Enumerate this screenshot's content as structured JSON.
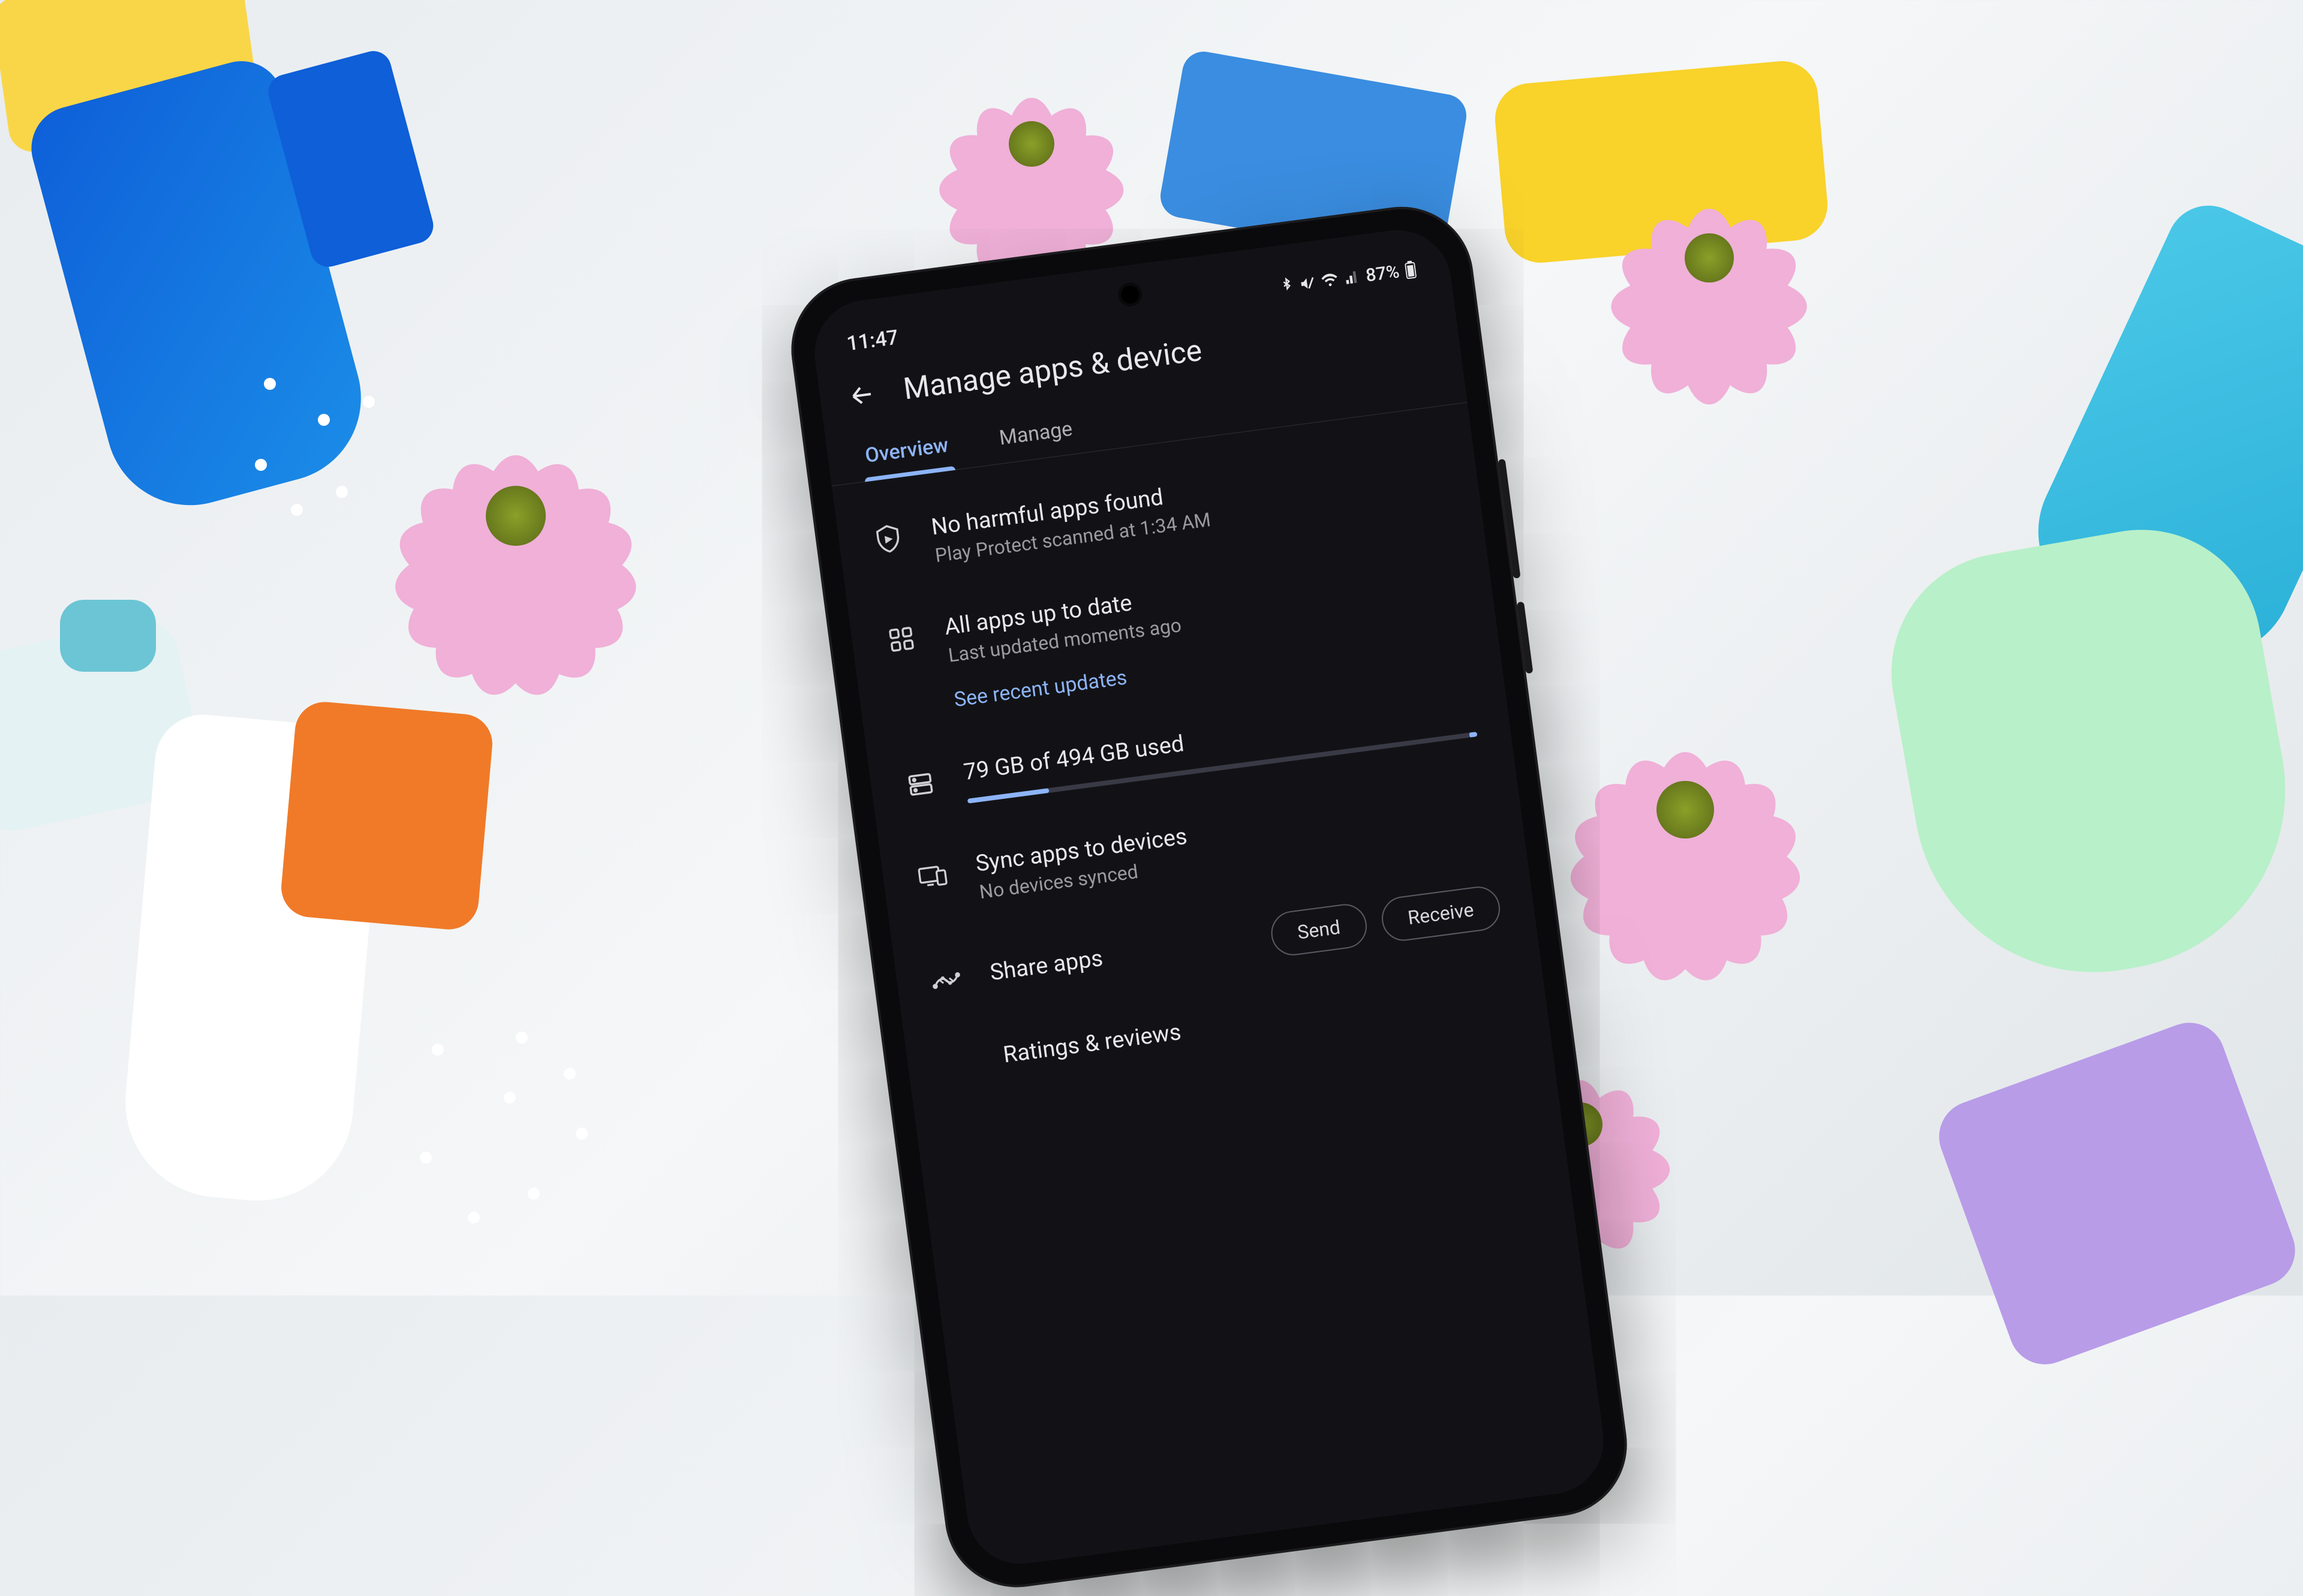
{
  "statusbar": {
    "time": "11:47",
    "battery_text": "87%"
  },
  "header": {
    "title": "Manage apps & device"
  },
  "tabs": {
    "overview": "Overview",
    "manage": "Manage"
  },
  "protect": {
    "title": "No harmful apps found",
    "sub": "Play Protect scanned at 1:34 AM"
  },
  "updates": {
    "title": "All apps up to date",
    "sub": "Last updated moments ago",
    "link": "See recent updates"
  },
  "storage": {
    "label": "79 GB of 494 GB used",
    "used": 79,
    "total": 494
  },
  "sync": {
    "title": "Sync apps to devices",
    "sub": "No devices synced"
  },
  "share": {
    "label": "Share apps",
    "send": "Send",
    "receive": "Receive"
  },
  "ratings": {
    "title": "Ratings & reviews"
  }
}
